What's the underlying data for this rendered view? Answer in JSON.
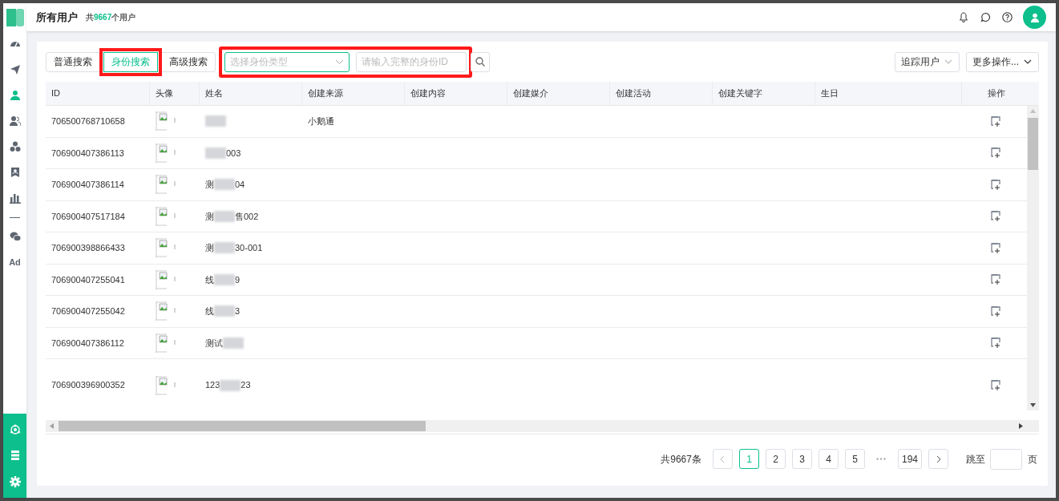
{
  "header": {
    "title": "所有用户",
    "count_prefix": "共",
    "count": "9667",
    "count_suffix": "个用户"
  },
  "sidebar": {
    "items": [
      {
        "kind": "dashboard",
        "selected": false
      },
      {
        "kind": "send",
        "selected": false
      },
      {
        "kind": "user",
        "selected": true
      },
      {
        "kind": "users",
        "selected": false
      },
      {
        "kind": "group",
        "selected": false
      },
      {
        "kind": "badge",
        "selected": false
      },
      {
        "kind": "chart",
        "selected": false
      },
      {
        "kind": "divider"
      },
      {
        "kind": "chat",
        "selected": false
      },
      {
        "kind": "ad",
        "label": "Ad",
        "selected": false
      }
    ],
    "bottom": [
      {
        "kind": "network"
      },
      {
        "kind": "list"
      },
      {
        "kind": "settings"
      }
    ]
  },
  "search_tabs": [
    {
      "label": "普通搜索",
      "selected": false,
      "highlight": false
    },
    {
      "label": "身份搜索",
      "selected": true,
      "highlight": true
    },
    {
      "label": "高级搜索",
      "selected": false,
      "highlight": false
    }
  ],
  "identity_search": {
    "highlight": true,
    "type_select": {
      "placeholder": "选择身份类型"
    },
    "id_input": {
      "placeholder": "请输入完整的身份ID"
    }
  },
  "actions": [
    {
      "label": "追踪用户"
    },
    {
      "label": "更多操作..."
    }
  ],
  "table": {
    "columns": [
      "ID",
      "头像",
      "姓名",
      "创建来源",
      "创建内容",
      "创建媒介",
      "创建活动",
      "创建关键字",
      "生日",
      "操作"
    ],
    "rows": [
      {
        "id": "706500768710658",
        "name_before": "",
        "name_after": "",
        "source": "小鹅通",
        "tall": false
      },
      {
        "id": "706900407386113",
        "name_before": "",
        "name_after": "003",
        "tall": false
      },
      {
        "id": "706900407386114",
        "name_before": "测",
        "name_after": "04",
        "tall": false
      },
      {
        "id": "706900407517184",
        "name_before": "测",
        "name_after": "售002",
        "tall": false
      },
      {
        "id": "706900398866433",
        "name_before": "测",
        "name_after": "30-001",
        "tall": false
      },
      {
        "id": "706900407255041",
        "name_before": "线",
        "name_after": "9",
        "tall": false
      },
      {
        "id": "706900407255042",
        "name_before": "线",
        "name_after": "3",
        "tall": false
      },
      {
        "id": "706900407386112",
        "name_before": "测试",
        "name_after": "",
        "tall": false
      },
      {
        "id": "706900396900352",
        "name_before": "123",
        "name_after": "23",
        "tall": true
      }
    ]
  },
  "pagination": {
    "total": "共9667条",
    "pages": [
      {
        "label": "1",
        "selected": true
      },
      {
        "label": "2",
        "selected": false
      },
      {
        "label": "3",
        "selected": false
      },
      {
        "label": "4",
        "selected": false
      },
      {
        "label": "5",
        "selected": false
      },
      {
        "label": "•••",
        "kind": "ellipsis"
      },
      {
        "label": "194",
        "selected": false
      }
    ],
    "jump_label": "跳至",
    "page_label": "页"
  }
}
